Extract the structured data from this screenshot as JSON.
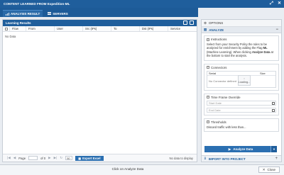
{
  "window": {
    "title": "CONTENT LEARNED FROM Expedition-ML"
  },
  "tabs": [
    {
      "label": "ANALYSIS RESULT",
      "active": true
    },
    {
      "label": "SERVERS",
      "active": false
    }
  ],
  "left_panel": {
    "title": "Learning Results",
    "columns": [
      "Flow",
      "From",
      "User",
      "Src (IPs)",
      "To",
      "Dst (IPs)",
      "Service"
    ],
    "empty_text": "No Data",
    "pager": {
      "page_label": "Page",
      "of_label": "of 0",
      "page_size": "50",
      "export_label": "Export Excel",
      "status": "No data to display"
    }
  },
  "right_panel": {
    "options_label": "OPTIONS",
    "analyze_label": "ANALYZE",
    "instructions_title": "Instructions",
    "instructions_text": "Select from your Security Policy the rules to be analyzed for enrichment by adding the Flag <b>ML</b> (Machine Learning). When clicking <b>Analyze Data</b> at the bottom to start the analysis.",
    "connectors_title": "Connectors",
    "connectors_cols": [
      "Serial",
      "Size"
    ],
    "connectors_empty": "No Connector defined",
    "loading_text": "Loading...",
    "timeframe_title": "Time Frame Override",
    "start_placeholder": "Start Date",
    "end_placeholder": "End Date",
    "thresholds_title": "Thresholds",
    "thresholds_text": "Discard traffic with less than...",
    "analyze_button": "Analyze Data",
    "import_label": "IMPORT INTO PROJECT"
  },
  "footer": {
    "analyze_link": "Click on Analyze Data",
    "close_label": "Close"
  },
  "colors": {
    "primary": "#1f5e9c",
    "button": "#2b6fb1"
  }
}
